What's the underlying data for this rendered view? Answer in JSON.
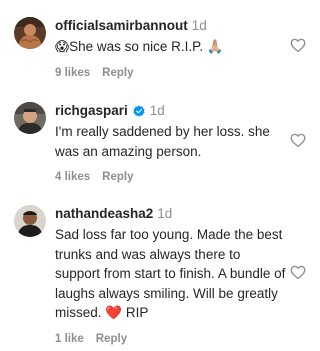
{
  "comments": [
    {
      "username": "officialsamirbannout",
      "time": "1d",
      "verified": false,
      "text": "😱She was so nice R.I.P. 🙏🏼",
      "likes": "9 likes",
      "reply_label": "Reply"
    },
    {
      "username": "richgaspari",
      "time": "1d",
      "verified": true,
      "text": "I'm really saddened by her loss. she was an amazing person.",
      "likes": "4 likes",
      "reply_label": "Reply"
    },
    {
      "username": "nathandeasha2",
      "time": "1d",
      "verified": false,
      "text": "Sad loss far too young. Made the best trunks and was always there to support from start to finish. A bundle of laughs always smiling. Will be greatly missed. ❤️ RIP",
      "likes": "1 like",
      "reply_label": "Reply"
    }
  ],
  "colors": {
    "username": "#262626",
    "secondary": "#8e8e8e",
    "verified": "#0095f6"
  },
  "icons": {
    "like": "heart-outline-icon",
    "verified": "verified-badge-icon"
  }
}
